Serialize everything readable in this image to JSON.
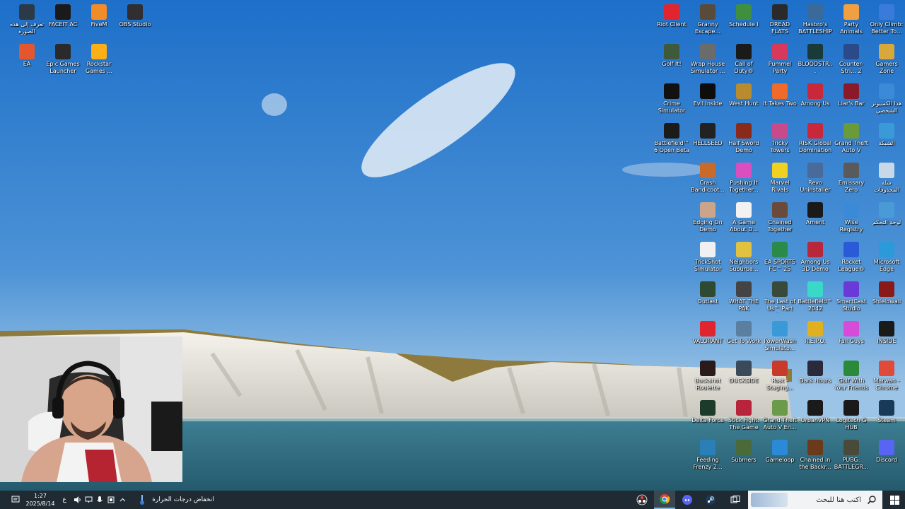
{
  "desktop": {
    "icons_left": [
      {
        "label": "تعرف إلى هذه الصورة",
        "icon": "info-camera-icon",
        "color": "#2b3a46"
      },
      {
        "label": "FACEIT AC",
        "icon": "faceit-icon",
        "color": "#1a1a1a"
      },
      {
        "label": "FiveM",
        "icon": "fivem-icon",
        "color": "#f28c28"
      },
      {
        "label": "OBS Studio",
        "icon": "obs-icon",
        "color": "#302e31"
      },
      {
        "label": "EA",
        "icon": "ea-icon",
        "color": "#e4572e"
      },
      {
        "label": "Epic Games Launcher",
        "icon": "epic-icon",
        "color": "#2a2a2a"
      },
      {
        "label": "Rockstar Games ...",
        "icon": "rockstar-icon",
        "color": "#fcaf17"
      }
    ],
    "icon_columns": [
      [
        {
          "label": "Riot Client",
          "color": "#e0252f"
        },
        {
          "label": "Golf It!",
          "color": "#3f5a3a"
        },
        {
          "label": "Crime Simulator",
          "color": "#111111"
        },
        {
          "label": "Battlefield™ 6 Open Beta",
          "color": "#1b1b1b"
        }
      ],
      [
        {
          "label": "Granny Escape...",
          "color": "#5a4a3a"
        },
        {
          "label": "Wrap House Simulator ...",
          "color": "#6b6b6b"
        },
        {
          "label": "Evil Inside",
          "color": "#0d0d0d"
        },
        {
          "label": "HELLSEED",
          "color": "#222222"
        },
        {
          "label": "Crash Bandicoot...",
          "color": "#c86a2a"
        },
        {
          "label": "Edging On Demo",
          "color": "#caa58a"
        },
        {
          "label": "TrickShot Simulator",
          "color": "#f0f0f0"
        },
        {
          "label": "Outlast",
          "color": "#2e4a32"
        },
        {
          "label": "VALORANT",
          "color": "#e0252f"
        },
        {
          "label": "Buckshot Roulette",
          "color": "#2a1a1a"
        },
        {
          "label": "Delta Force",
          "color": "#1d3b2a"
        },
        {
          "label": "Feeding Frenzy 2...",
          "color": "#2b7fb8"
        }
      ],
      [
        {
          "label": "Schedule I",
          "color": "#3f8f3f"
        },
        {
          "label": "Call of Duty®",
          "color": "#1a1a1a"
        },
        {
          "label": "West Hunt",
          "color": "#b78b2e"
        },
        {
          "label": "Half Sword Demo",
          "color": "#8a2a1a"
        },
        {
          "label": "Pushing It Together...",
          "color": "#d94fbf"
        },
        {
          "label": "A Game About D...",
          "color": "#f2f2f2"
        },
        {
          "label": "Neighbors Suburba...",
          "color": "#e0c240"
        },
        {
          "label": "WHAT THE PAK",
          "color": "#444444"
        },
        {
          "label": "Get To Work",
          "color": "#5a7f9f"
        },
        {
          "label": "DUCKSIDE",
          "color": "#3a4a5a"
        },
        {
          "label": "Stick Fight: The Game",
          "color": "#b8243a"
        },
        {
          "label": "Submers",
          "color": "#4a6a3a"
        }
      ],
      [
        {
          "label": "DREAD FLATS Demo",
          "color": "#2a2a2a"
        },
        {
          "label": "Pummel Party",
          "color": "#d8385a"
        },
        {
          "label": "It Takes Two",
          "color": "#f06a2a"
        },
        {
          "label": "Tricky Towers",
          "color": "#c84a8a"
        },
        {
          "label": "Marvel Rivals",
          "color": "#f0d020"
        },
        {
          "label": "Chained Together",
          "color": "#6a4a3a"
        },
        {
          "label": "EA SPORTS FC™ 25",
          "color": "#2a8a4a"
        },
        {
          "label": "The Last of Us™ Part II...",
          "color": "#3a4a3a"
        },
        {
          "label": "PowerWash Simulato...",
          "color": "#3a9ad8"
        },
        {
          "label": "Rust - Staging...",
          "color": "#c83a2a"
        },
        {
          "label": "Grand Theft Auto V En...",
          "color": "#6a9a4a"
        },
        {
          "label": "Gameloop",
          "color": "#2a8ad8"
        }
      ],
      [
        {
          "label": "Hasbro's BATTLESHIP",
          "color": "#3a6a9a"
        },
        {
          "label": "BLOODSTR...",
          "color": "#1a3a3a"
        },
        {
          "label": "Among Us",
          "color": "#c8283a"
        },
        {
          "label": "RISK Global Domination",
          "color": "#c8283a"
        },
        {
          "label": "Revo Uninstaller",
          "color": "#4a6a9a"
        },
        {
          "label": "Ament",
          "color": "#1a1a1a"
        },
        {
          "label": "Among Us 3D Demo",
          "color": "#b8283a"
        },
        {
          "label": "Battlefield™ 2042",
          "color": "#3ad8c8"
        },
        {
          "label": "R.E.P.O.",
          "color": "#e0b020"
        },
        {
          "label": "Dark Hours",
          "color": "#2a2a3a"
        },
        {
          "label": "UrbanVPN",
          "color": "#1a1a1a"
        },
        {
          "label": "Chained in the Backr...",
          "color": "#6a3a1a"
        }
      ],
      [
        {
          "label": "Party Animals",
          "color": "#f0a040"
        },
        {
          "label": "Counter-Stri... 2",
          "color": "#2a4a8a"
        },
        {
          "label": "Liar's Bar",
          "color": "#8a1a2a"
        },
        {
          "label": "Grand Theft Auto V",
          "color": "#6a9a3a"
        },
        {
          "label": "Emissary Zero",
          "color": "#5a5a5a"
        },
        {
          "label": "Wise Registry Cleaner",
          "color": "#3a8ad8"
        },
        {
          "label": "Rocket League®",
          "color": "#2a5ad8"
        },
        {
          "label": "SmartCast Studio",
          "color": "#6a3ad8"
        },
        {
          "label": "Fall Guys",
          "color": "#d84ad8"
        },
        {
          "label": "Golf With Your Friends",
          "color": "#2a8a3a"
        },
        {
          "label": "Logitech G HUB",
          "color": "#1a1a1a"
        },
        {
          "label": "PUBG: BATTLEGR...",
          "color": "#4a4a3a"
        }
      ],
      [
        {
          "label": "Only Climb: Better To...",
          "color": "#3a7ad8"
        },
        {
          "label": "Gamers Zone",
          "color": "#d8a83a"
        },
        {
          "label": "هذا الكمبيوتر الشخصي",
          "color": "#3a8ad8"
        },
        {
          "label": "الشبكة",
          "color": "#3a9ad8"
        },
        {
          "label": "سلة المحذوفات",
          "color": "#c8d8e8"
        },
        {
          "label": "لوحة التحكم",
          "color": "#4a9ad8"
        },
        {
          "label": "Microsoft Edge",
          "color": "#2a9ad8"
        },
        {
          "label": "Shieldwall",
          "color": "#8a1a1a"
        },
        {
          "label": "INSIDE",
          "color": "#1a1a1a"
        },
        {
          "label": "Marwan - Chrome",
          "color": "#e04a3a"
        },
        {
          "label": "Steam",
          "color": "#1a3a5a"
        },
        {
          "label": "Discord",
          "color": "#5865f2"
        }
      ]
    ]
  },
  "taskbar": {
    "search_placeholder": "اكتب هنا للبحث",
    "weather_text": "انخفاض درجات الحرارة",
    "time": "1:27",
    "date": "2025/8/14",
    "language": "ع",
    "pinned": [
      "obs-icon",
      "chrome-icon",
      "discord-icon",
      "steam-icon",
      "task-view-icon"
    ],
    "accent": "#1f2a33"
  }
}
